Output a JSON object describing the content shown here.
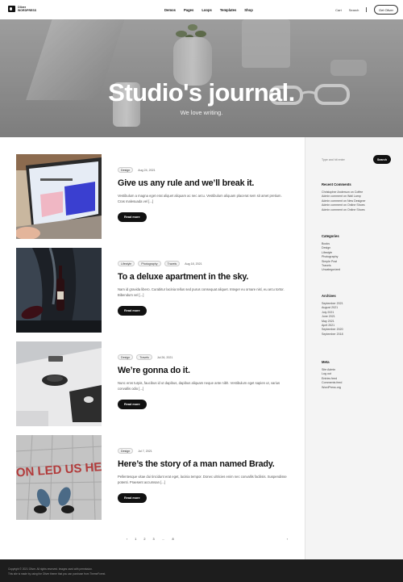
{
  "header": {
    "logo": {
      "line1": "Oliver",
      "line2": "WORDPRESS"
    },
    "nav": [
      "Demos",
      "Pages",
      "Loops",
      "Templates",
      "Shop"
    ],
    "cart": "Cart",
    "search": "Search",
    "cta": "Get Oliver"
  },
  "hero": {
    "title": "Studio's journal.",
    "subtitle": "We love writing."
  },
  "posts": [
    {
      "tags": [
        "Design"
      ],
      "date": "Aug 24, 2021",
      "title": "Give us any rule and we’ll break it.",
      "excerpt": "Vestibulum a magna eget erat aliquet aliquam ac nec arcu. Vestibulum aliquam placerat sem sit amet pretium. Cras malesuada vel [...]",
      "read_more": "Read more"
    },
    {
      "tags": [
        "Lifestyle",
        "Photography",
        "Travels"
      ],
      "date": "Aug 18, 2021",
      "title": "To a deluxe apartment in the sky.",
      "excerpt": "Nam id gravida libero. Curabitur lacinia tellus sed purus consequat aliquet. Integer eu ornare nisl, eu arcu tortor. Bibendum vel [...]",
      "read_more": "Read more"
    },
    {
      "tags": [
        "Design",
        "Travels"
      ],
      "date": "Jul 26, 2021",
      "title": "We’re gonna do it.",
      "excerpt": "Nunc eros turpis, faucibus id ut dapibus, dapibus aliquam neque ante nibh. Vestibulum eget sapien ut, varius convallis odio [...]",
      "read_more": "Read more"
    },
    {
      "tags": [
        "Design"
      ],
      "date": "Jul 7, 2021",
      "title": "Here’s the story of a man named Brady.",
      "excerpt": "Pellentesque vitae dui tincidunt erat eget, lacinia tempor. Donec ultricies enim nec convallis facilisis. Suspendisse potenti. Praesent accumsan [...]",
      "read_more": "Read more"
    }
  ],
  "pagination": {
    "pages": [
      "1",
      "2",
      "3",
      "…",
      "8"
    ],
    "next": "›",
    "prev": "‹"
  },
  "sidebar": {
    "search_placeholder": "Type and hit enter",
    "search_button": "Search",
    "recent_comments": {
      "title": "Recent Comments",
      "items": [
        "Christopher Anderson on Coffee",
        "Admin comment on Wall Lamp",
        "Admin comment on New Designer",
        "Admin comment on Online Shoes",
        "Admin comment on Online Shoes"
      ]
    },
    "categories": {
      "title": "Categories",
      "items": [
        "Books",
        "Design",
        "Lifestyle",
        "Photography",
        "Simple Post",
        "Travels",
        "Uncategorized"
      ]
    },
    "archives": {
      "title": "Archives",
      "items": [
        "September 2021",
        "August 2021",
        "July 2021",
        "June 2021",
        "May 2021",
        "April 2021",
        "September 2020",
        "September 2018"
      ]
    },
    "meta": {
      "title": "Meta",
      "items": [
        "Site Admin",
        "Log out",
        "Entries feed",
        "Comments feed",
        "WordPress.org"
      ]
    }
  },
  "footer": {
    "line1": "Copyright © 2021 Oliver. All rights reserved. Images used with permission.",
    "line2": "This site is made by using the Oliver theme that you can purchase from ThemeForest."
  }
}
